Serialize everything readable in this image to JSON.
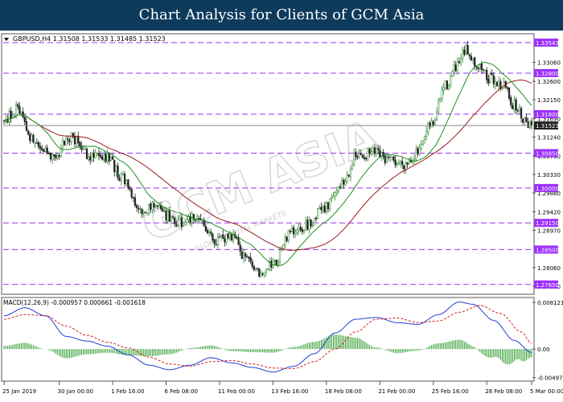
{
  "header": {
    "title": "Chart Analysis for Clients of GCM Asia"
  },
  "watermark": {
    "text": "GCM ASIA",
    "subtext": "GLOBAL CAPITAL MARKETS",
    "color": "#b8b8b8"
  },
  "chart_data": {
    "type": "candlestick",
    "symbol_line": "GBPUSD,H4  1.31508 1.31533 1.31485 1.31523",
    "price_panel": {
      "ylim": [
        1.2745,
        1.3372
      ],
      "current_price": 1.31523,
      "y_ticks": [
        1.3306,
        1.326,
        1.3215,
        1.3169,
        1.3124,
        1.3078,
        1.3033,
        1.2988,
        1.2942,
        1.2897,
        1.2806,
        1.2761
      ],
      "levels": [
        1.33543,
        1.328,
        1.318,
        1.3085,
        1.3,
        1.2915,
        1.285,
        1.2765
      ],
      "level_color": "#9b30ff",
      "candle_up_color": "#2a8a2a",
      "candle_down_color": "#222222",
      "ma_fast_color": "#1f8f1f",
      "ma_slow_color": "#9b1b1b",
      "anchors": [
        [
          0,
          1.3165
        ],
        [
          8,
          1.3195
        ],
        [
          18,
          1.311
        ],
        [
          28,
          1.307
        ],
        [
          38,
          1.3125
        ],
        [
          50,
          1.308
        ],
        [
          60,
          1.3075
        ],
        [
          68,
          1.3025
        ],
        [
          78,
          1.2945
        ],
        [
          88,
          1.2955
        ],
        [
          100,
          1.2915
        ],
        [
          112,
          1.2935
        ],
        [
          122,
          1.287
        ],
        [
          132,
          1.288
        ],
        [
          140,
          1.283
        ],
        [
          148,
          1.2795
        ],
        [
          158,
          1.2825
        ],
        [
          166,
          1.289
        ],
        [
          176,
          1.291
        ],
        [
          186,
          1.295
        ],
        [
          196,
          1.301
        ],
        [
          204,
          1.3075
        ],
        [
          214,
          1.3085
        ],
        [
          224,
          1.3065
        ],
        [
          232,
          1.306
        ],
        [
          240,
          1.3085
        ],
        [
          248,
          1.3155
        ],
        [
          256,
          1.325
        ],
        [
          262,
          1.329
        ],
        [
          268,
          1.3335
        ],
        [
          276,
          1.3295
        ],
        [
          282,
          1.3265
        ],
        [
          290,
          1.325
        ],
        [
          296,
          1.32
        ],
        [
          302,
          1.317
        ],
        [
          306,
          1.3152
        ]
      ]
    },
    "macd_panel": {
      "label": "MACD(12,26,9)  -0.000957  0.000661  -0.001618",
      "ylim": [
        -0.0053,
        0.0087
      ],
      "y_ticks": [
        0.008121,
        0.0,
        -0.004973
      ],
      "main_color": "#1f3fd6",
      "signal_color": "#d42020",
      "hist_color": "#2a9a2a",
      "main": [
        [
          0,
          0.0058
        ],
        [
          12,
          0.0072
        ],
        [
          24,
          0.0058
        ],
        [
          36,
          0.0022
        ],
        [
          48,
          0.0014
        ],
        [
          60,
          0.0005
        ],
        [
          72,
          -0.001
        ],
        [
          84,
          -0.0028
        ],
        [
          96,
          -0.0036
        ],
        [
          108,
          -0.0028
        ],
        [
          120,
          -0.0015
        ],
        [
          132,
          -0.0024
        ],
        [
          144,
          -0.0032
        ],
        [
          156,
          -0.004
        ],
        [
          168,
          -0.003
        ],
        [
          180,
          -0.0008
        ],
        [
          192,
          0.0028
        ],
        [
          204,
          0.0052
        ],
        [
          216,
          0.0055
        ],
        [
          228,
          0.0046
        ],
        [
          240,
          0.0043
        ],
        [
          252,
          0.006
        ],
        [
          264,
          0.0082
        ],
        [
          272,
          0.0078
        ],
        [
          284,
          0.005
        ],
        [
          296,
          0.0015
        ],
        [
          306,
          -0.0006
        ]
      ],
      "signal": [
        [
          0,
          0.0052
        ],
        [
          12,
          0.006
        ],
        [
          24,
          0.0058
        ],
        [
          36,
          0.004
        ],
        [
          48,
          0.0024
        ],
        [
          60,
          0.0012
        ],
        [
          72,
          0.0002
        ],
        [
          84,
          -0.0014
        ],
        [
          96,
          -0.0026
        ],
        [
          108,
          -0.003
        ],
        [
          120,
          -0.0022
        ],
        [
          132,
          -0.002
        ],
        [
          144,
          -0.0026
        ],
        [
          156,
          -0.0033
        ],
        [
          168,
          -0.0034
        ],
        [
          180,
          -0.0022
        ],
        [
          192,
          0.0
        ],
        [
          204,
          0.003
        ],
        [
          216,
          0.0052
        ],
        [
          228,
          0.0054
        ],
        [
          240,
          0.0046
        ],
        [
          252,
          0.0049
        ],
        [
          264,
          0.0064
        ],
        [
          276,
          0.0076
        ],
        [
          288,
          0.0062
        ],
        [
          300,
          0.003
        ],
        [
          306,
          0.001
        ]
      ]
    },
    "x_labels": [
      {
        "idx": 0,
        "text": "25 Jan 2019"
      },
      {
        "idx": 32,
        "text": "30 Jan 00:00"
      },
      {
        "idx": 63,
        "text": "1 Feb 16:00"
      },
      {
        "idx": 94,
        "text": "6 Feb 08:00"
      },
      {
        "idx": 125,
        "text": "11 Feb 00:00"
      },
      {
        "idx": 156,
        "text": "13 Feb 16:00"
      },
      {
        "idx": 187,
        "text": "18 Feb 08:00"
      },
      {
        "idx": 218,
        "text": "21 Feb 00:00"
      },
      {
        "idx": 249,
        "text": "25 Feb 16:00"
      },
      {
        "idx": 280,
        "text": "28 Feb 08:00"
      },
      {
        "idx": 306,
        "text": "5 Mar 00:00"
      }
    ]
  }
}
